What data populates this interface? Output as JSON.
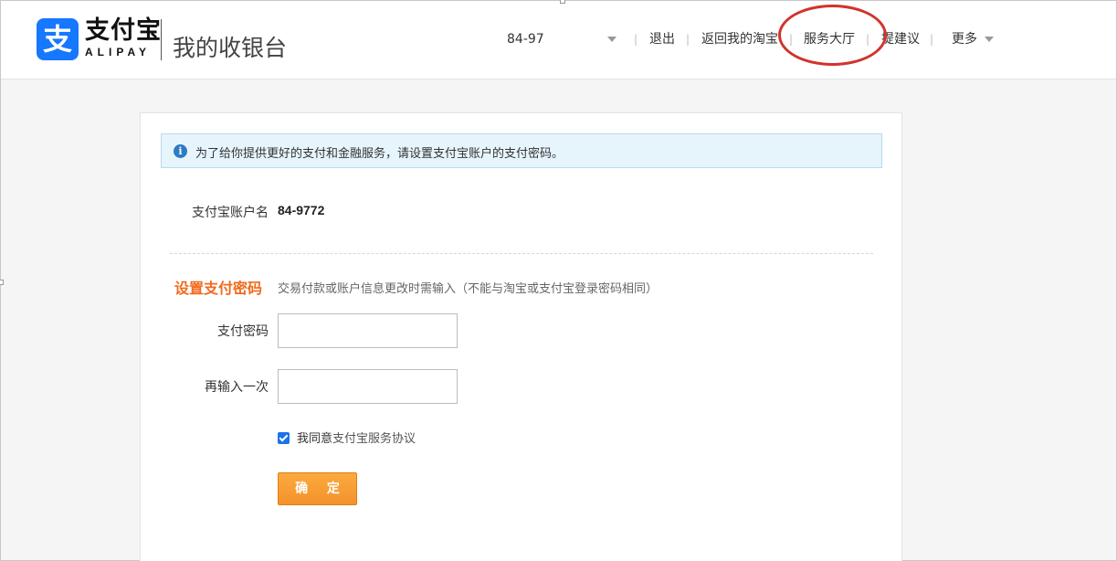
{
  "header": {
    "logo_glyph": "支",
    "brand_cn": "支付宝",
    "brand_en": "ALIPAY",
    "app_title": "我的收银台",
    "account_short": "84-97",
    "nav": {
      "logout": "退出",
      "back_taobao": "返回我的淘宝",
      "service_hall": "服务大厅",
      "suggest": "提建议",
      "more": "更多",
      "separator": "|"
    }
  },
  "notice": {
    "icon_glyph": "i",
    "text": "为了给你提供更好的支付和金融服务，请设置支付宝账户的支付密码。"
  },
  "account": {
    "label": "支付宝账户名",
    "value": "84-9772"
  },
  "password_section": {
    "title": "设置支付密码",
    "hint": "交易付款或账户信息更改时需输入（不能与淘宝或支付宝登录密码相同）",
    "password_label": "支付密码",
    "confirm_label": "再输入一次"
  },
  "agreement": {
    "checked": true,
    "prefix": "我同意",
    "link_text": "支付宝服务协议"
  },
  "submit_label": "确 定",
  "colors": {
    "brand_blue": "#1677ff",
    "accent_orange": "#f06a1d",
    "button_orange": "#f3922a",
    "annotation_red": "#d0342c"
  }
}
